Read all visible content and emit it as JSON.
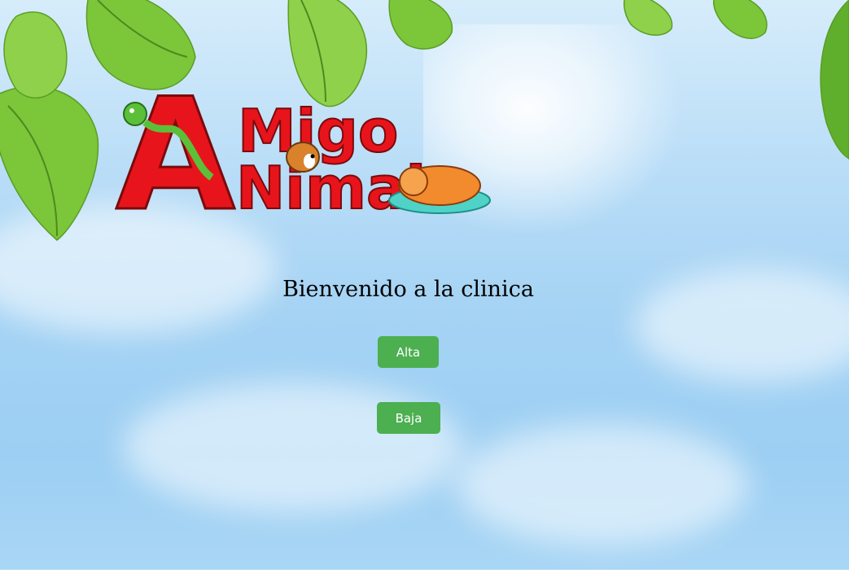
{
  "logo": {
    "line1": "Migo",
    "line2": "Nimal",
    "initial": "A"
  },
  "welcome_text": "Bienvenido a la clinica",
  "buttons": {
    "alta_label": "Alta",
    "baja_label": "Baja"
  },
  "colors": {
    "button": "#4caf50",
    "logo_red": "#e8141b",
    "sky": "#a5d3f4",
    "leaf": "#7cc63a"
  }
}
